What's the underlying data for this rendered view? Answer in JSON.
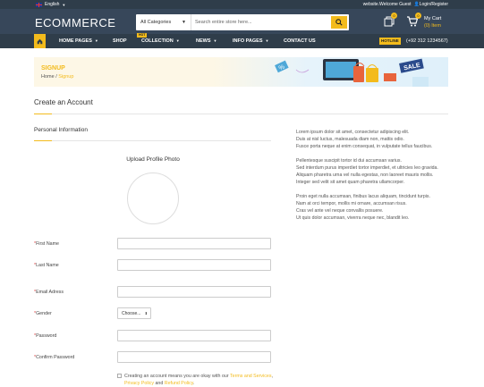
{
  "topbar": {
    "language": "English",
    "welcome": "website.Welcome Guest",
    "login": "Login/Register"
  },
  "header": {
    "logo": "ECOMMERCE",
    "search_category": "All Categories",
    "search_placeholder": "Search entire store here...",
    "compare_count": "0",
    "cart_count": "0",
    "cart_label": "My Cart",
    "cart_items": "(0) Item"
  },
  "nav": {
    "items": [
      "HOME PAGES",
      "SHOP",
      "COLLECTION",
      "NEWS",
      "INFO PAGES",
      "CONTACT US"
    ],
    "hot_badge": "HOT",
    "hotline_label": "HOTLINE",
    "phone": "(+92 312 1234567)"
  },
  "banner": {
    "title": "SIGNUP",
    "crumb_home": "Home",
    "crumb_sep": "/",
    "crumb_current": "Signup",
    "sale": "SALE",
    "tag": "%"
  },
  "form": {
    "heading": "Create an Account",
    "section": "Personal Information",
    "upload_label": "Upload Profile Photo",
    "required_mark": "*",
    "labels": {
      "first_name": "First Name",
      "last_name": "Last Name",
      "email": "Email Adress",
      "gender": "Gender",
      "password": "Password",
      "confirm_password": "Confirm Password"
    },
    "gender_value": "Choose...",
    "terms_prefix": "Creating an account means you are okay with our ",
    "terms_link": "Terms and Services",
    "sep": ", ",
    "privacy_link": "Privacy Policy",
    "and": " and ",
    "refund_link": "Refund Policy",
    "end": "."
  },
  "info": {
    "p1": [
      "Lorem ipsum dolor sit amet, consectetur adipiscing elit.",
      "Duis at nisl luctus, malesuada diam non, mattis odio.",
      "Fusce porta neque at enim consequat, in vulputate tellus faucibus."
    ],
    "p2": [
      "Pellentesque suscipit tortor id dui accumsan varius.",
      "Sed interdum purus imperdiet tortor imperdiet, et ultricies leo gravida.",
      "Aliquam pharetra urna vel nulla egestas, non laoreet mauris mollis.",
      "Integer sed velit sit amet quam pharetra ullamcorper."
    ],
    "p3": [
      "Proin eget nulla accumsan, finibus lacus aliquam, tincidunt turpis.",
      "Nam at orci tempor, mollis mi ornare, accumsan risus.",
      "Cras vel ante vel neque convallis posuere.",
      "Ut quis dolor accumsan, viverra neque nec, blandit leo."
    ]
  },
  "colors": {
    "accent": "#f3bb1c",
    "header": "#37475a",
    "nav": "#2f3d4a"
  }
}
